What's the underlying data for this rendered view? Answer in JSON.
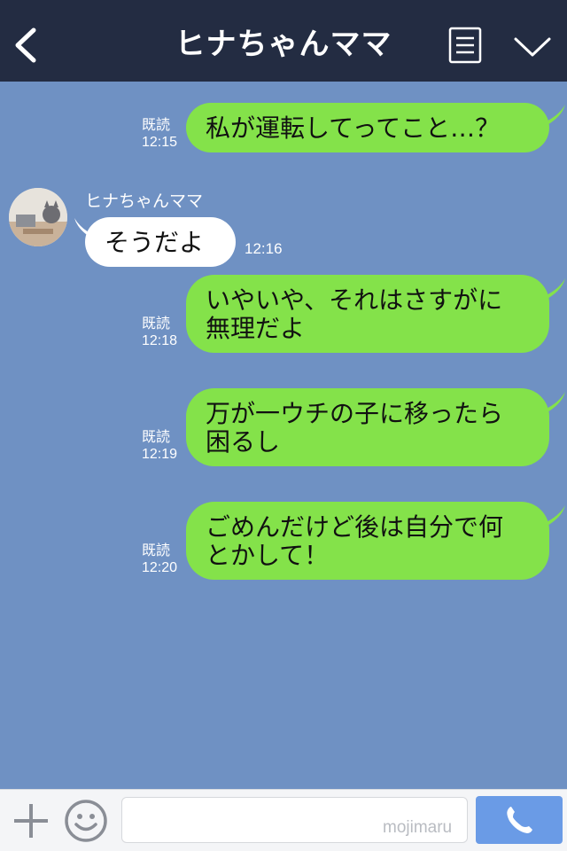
{
  "header": {
    "title": "ヒナちゃんママ",
    "back_icon": "chevron-left-icon",
    "menu_icon": "menu-icon",
    "expand_icon": "chevron-down-icon"
  },
  "colors": {
    "header_bg": "#232c42",
    "chat_bg": "#6f91c3",
    "sent_bubble": "#84e24a",
    "received_bubble": "#ffffff",
    "call_button": "#6a9be6"
  },
  "messages": [
    {
      "direction": "sent",
      "lines": [
        "私が運転してってこと…？"
      ],
      "read_label": "既読",
      "time": "12:15"
    },
    {
      "direction": "received",
      "sender": "ヒナちゃんママ",
      "lines": [
        "そうだよ"
      ],
      "time": "12:16"
    },
    {
      "direction": "sent",
      "lines": [
        "いやいや、それはさすがに",
        "無理だよ"
      ],
      "read_label": "既読",
      "time": "12:18"
    },
    {
      "direction": "sent",
      "lines": [
        "万が一ウチの子に移ったら",
        "困るし"
      ],
      "read_label": "既読",
      "time": "12:19"
    },
    {
      "direction": "sent",
      "lines": [
        "ごめんだけど後は自分で何",
        "とかして！"
      ],
      "read_label": "既読",
      "time": "12:20"
    }
  ],
  "footer": {
    "plus_icon": "plus-icon",
    "emoji_icon": "smiley-icon",
    "input_value": "",
    "watermark": "mojimaru",
    "call_icon": "phone-icon"
  }
}
